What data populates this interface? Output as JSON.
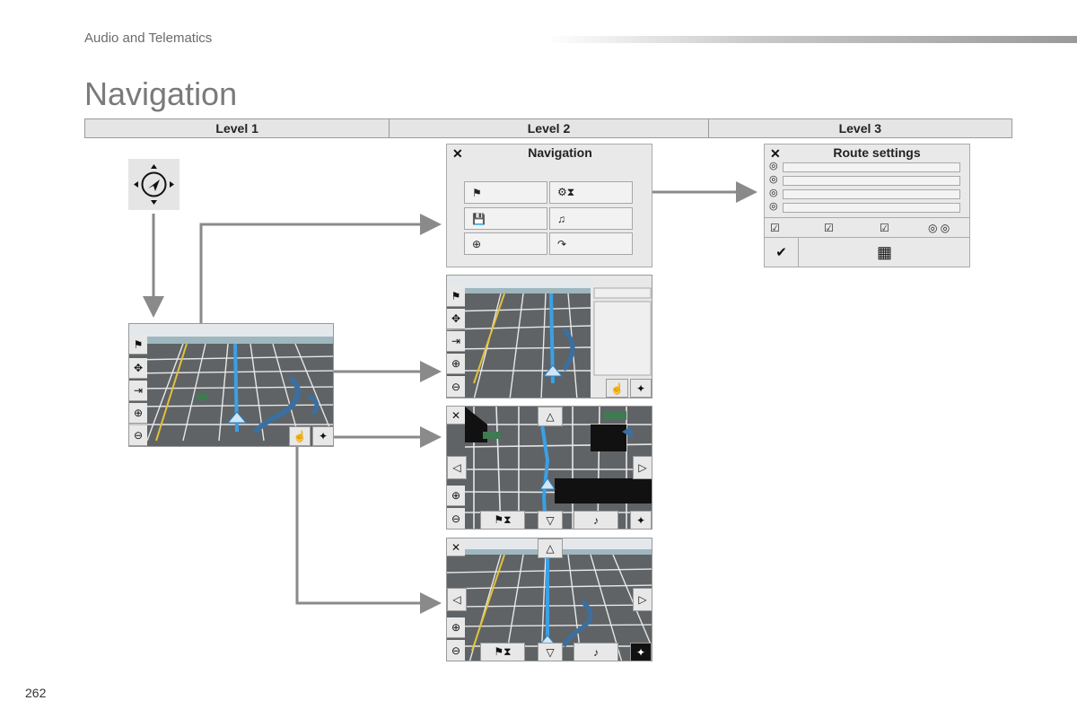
{
  "header": {
    "section": "Audio and Telematics",
    "title": "Navigation"
  },
  "levels": [
    "Level 1",
    "Level 2",
    "Level 3"
  ],
  "page_number": "262",
  "nav_menu": {
    "title": "Navigation",
    "close_icon": "✕",
    "buttons": [
      {
        "icon": "destination-flag-icon",
        "glyph": "⚑"
      },
      {
        "icon": "route-settings-icon",
        "glyph": "⚙⧗"
      },
      {
        "icon": "save-icon",
        "glyph": "💾"
      },
      {
        "icon": "voice-icon",
        "glyph": "♫"
      },
      {
        "icon": "position-icon",
        "glyph": "⊕"
      },
      {
        "icon": "detour-icon",
        "glyph": "↷"
      }
    ]
  },
  "route_settings": {
    "title": "Route settings",
    "close_icon": "✕",
    "options_count_label": "",
    "bullet": "◎",
    "check_glyphs": [
      "☑",
      "☑",
      "☑",
      "◎ ◎"
    ],
    "confirm_glyph": "✔",
    "map_glyph": "▦"
  },
  "map_controls": {
    "flag": "⚑",
    "move": "✥",
    "exit": "⇥",
    "zoom_in": "⊕",
    "zoom_out": "⊖",
    "hand": "☝",
    "compass": "✦",
    "close": "✕",
    "up": "△",
    "down": "▽",
    "left": "◁",
    "right": "▷",
    "dest": "⚑⧗",
    "note": "♪"
  },
  "colors": {
    "map_bg": "#5f6366",
    "road": "#e7e7e7",
    "route": "#3ba0e6",
    "water": "#3b6fa0",
    "park": "#3f7a52",
    "arrow": "#8a8a8a"
  }
}
